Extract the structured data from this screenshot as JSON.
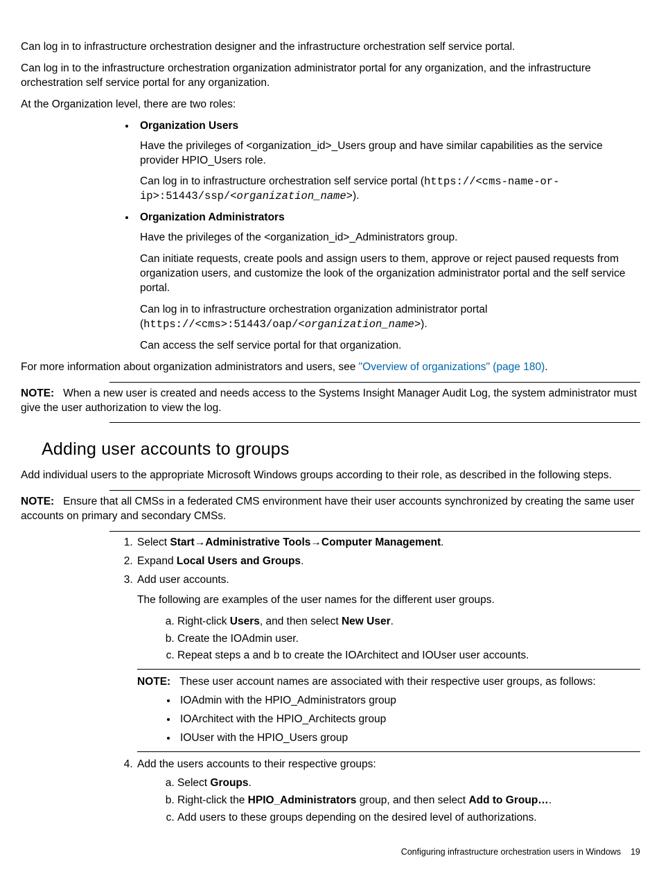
{
  "top": {
    "p1": "Can log in to infrastructure orchestration designer and the infrastructure orchestration self service portal.",
    "p2": "Can log in to the infrastructure orchestration organization administrator portal for any organization, and the infrastructure orchestration self service portal for any organization."
  },
  "org_intro": "At the Organization level, there are two roles:",
  "org_users": {
    "title": "Organization Users",
    "p1": "Have the privileges of <organization_id>_Users group and have similar capabilities as the service provider HPIO_Users role.",
    "p2a": "Can log in to infrastructure orchestration self service portal (",
    "p2b": "https://<cms-name-or-ip>:51443/ssp/",
    "p2c": "<organization_name>",
    "p2d": ")."
  },
  "org_admins": {
    "title": "Organization Administrators",
    "p1": "Have the privileges of the <organization_id>_Administrators group.",
    "p2": "Can initiate requests, create pools and assign users to them, approve or reject paused requests from organization users, and customize the look of the organization administrator portal and the self service portal.",
    "p3a": "Can log in to infrastructure orchestration organization administrator portal (",
    "p3b": "https://<cms>:51443/oap/",
    "p3c": "<organization_name>",
    "p3d": ").",
    "p4": "Can access the self service portal for that organization."
  },
  "more_info_pre": "For more information about organization administrators and users, see ",
  "more_info_link": "\"Overview of organizations\" (page 180)",
  "more_info_post": ".",
  "note1_label": "NOTE:",
  "note1_text": "When a new user is created and needs access to the Systems Insight Manager Audit Log, the system administrator must give the user authorization to view the log.",
  "section_title": "Adding user accounts to groups",
  "section_intro": "Add individual users to the appropriate Microsoft Windows groups according to their role, as described in the following steps.",
  "note2_label": "NOTE:",
  "note2_text": "Ensure that all CMSs in a federated CMS environment have their user accounts synchronized by creating the same user accounts on primary and secondary CMSs.",
  "step1": {
    "pre": "Select ",
    "b1": "Start",
    "arrow1": "→",
    "b2": "Administrative Tools",
    "arrow2": "→",
    "b3": "Computer Management",
    "post": "."
  },
  "step2": {
    "pre": "Expand ",
    "b": "Local Users and Groups",
    "post": "."
  },
  "step3": {
    "title": "Add user accounts.",
    "desc": "The following are examples of the user names for the different user groups.",
    "a_pre": "Right-click ",
    "a_b1": "Users",
    "a_mid": ", and then select ",
    "a_b2": "New User",
    "a_post": ".",
    "b": "Create the IOAdmin user.",
    "c": "Repeat steps a and b to create the IOArchitect and IOUser user accounts.",
    "note_label": "NOTE:",
    "note_text": "These user account names are associated with their respective user groups, as follows:",
    "bul1": "IOAdmin with the HPIO_Administrators group",
    "bul2": "IOArchitect with the HPIO_Architects group",
    "bul3": "IOUser with the HPIO_Users group"
  },
  "step4": {
    "title": "Add the users accounts to their respective groups:",
    "a_pre": "Select ",
    "a_b": "Groups",
    "a_post": ".",
    "b_pre": "Right-click the ",
    "b_b1": "HPIO_Administrators",
    "b_mid": " group, and then select ",
    "b_b2": "Add to Group…",
    "b_post": ".",
    "c": "Add users to these groups depending on the desired level of authorizations."
  },
  "footer_text": "Configuring infrastructure orchestration users in Windows",
  "footer_page": "19"
}
